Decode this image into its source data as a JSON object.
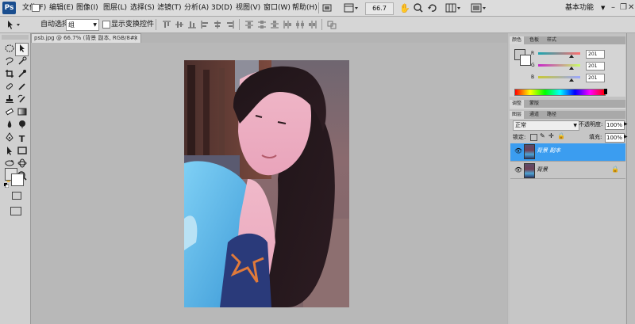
{
  "app": {
    "logo_text": "Ps"
  },
  "menu": {
    "items": [
      "文件(F)",
      "编辑(E)",
      "图像(I)",
      "图层(L)",
      "选择(S)",
      "滤镜(T)",
      "分析(A)",
      "3D(D)",
      "视图(V)",
      "窗口(W)",
      "帮助(H)"
    ]
  },
  "menubar": {
    "zoom": "66.7",
    "workspace": "基本功能"
  },
  "options": {
    "auto_select_label": "自动选择:",
    "auto_select_value": "组",
    "transform_label": "显示变换控件"
  },
  "document": {
    "tab_title": "psb.jpg @ 66.7% (背景 副本, RGB/8#) *",
    "close_glyph": "×"
  },
  "panels": {
    "color_tabs": [
      "颜色",
      "色板",
      "样式"
    ],
    "adjust_tabs": [
      "调整",
      "蒙版"
    ],
    "layer_tabs": [
      "图层",
      "通道",
      "路径"
    ]
  },
  "color_panel": {
    "channels": [
      {
        "label": "R",
        "value": "201",
        "level": 0.79,
        "gradient": [
          "#1aa6b0",
          "#ff6f6f"
        ]
      },
      {
        "label": "G",
        "value": "201",
        "level": 0.79,
        "gradient": [
          "#c828c8",
          "#c8ff64"
        ]
      },
      {
        "label": "B",
        "value": "201",
        "level": 0.79,
        "gradient": [
          "#c8c832",
          "#9aa6ff"
        ]
      }
    ]
  },
  "layers_panel": {
    "blend_mode": "正常",
    "opacity_label": "不透明度:",
    "opacity_value": "100%",
    "lock_label": "锁定:",
    "fill_label": "填充:",
    "fill_value": "100%",
    "layers": [
      {
        "name": "背景 副本",
        "selected": true
      },
      {
        "name": "背景",
        "selected": false
      }
    ]
  },
  "colors": {
    "selected_layer": "#3b9df0",
    "accent": "#1a4e8f"
  }
}
